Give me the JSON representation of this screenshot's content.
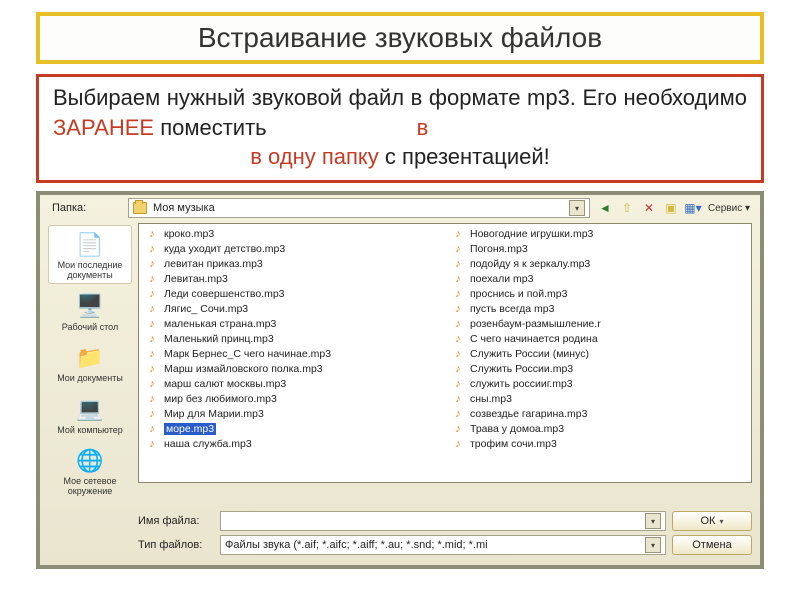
{
  "slide": {
    "title": "Встраивание звуковых файлов",
    "info_line1_pre": "Выбираем нужный звуковой файл в формате mp3. Его необходимо ",
    "info_line1_red1": "ЗАРАНЕЕ",
    "info_line1_mid": " поместить",
    "info_line2_red": "в одну папку",
    "info_line2_rest": " с презентацией!"
  },
  "dialog": {
    "folder_label": "Папка:",
    "folder_value": "Моя музыка",
    "service_label": "Сервис ▾"
  },
  "sidebar": {
    "items": [
      {
        "label": "Мои последние документы"
      },
      {
        "label": "Рабочий стол"
      },
      {
        "label": "Мои документы"
      },
      {
        "label": "Мой компьютер"
      },
      {
        "label": "Мое сетевое окружение"
      }
    ]
  },
  "files": {
    "col1": [
      "кроко.mp3",
      "куда уходит детство.mp3",
      "левитан приказ.mp3",
      "Левитан.mp3",
      "Леди совершенство.mp3",
      "Лягис_ Сочи.mp3",
      "маленькая страна.mp3",
      "Маленький принц.mp3",
      "Марк Бернес_С чего начинае.mp3",
      "Марш измайловского полка.mp3",
      "марш салют москвы.mp3",
      "мир без любимого.mp3",
      "Мир для Марии.mp3",
      "море.mp3",
      "наша служба.mp3"
    ],
    "col2": [
      "Новогодние игрушки.mp3",
      "Погоня.mp3",
      "подойду я к зеркалу.mp3",
      "поехали mp3",
      "проснись и пой.mp3",
      "пусть всегда mp3",
      "розенбаум-размышление.r",
      "С чего начинается родина",
      "Служить России (минус)",
      "Служить России.mp3",
      "служить россииг.mp3",
      "сны.mp3",
      "созвездье гагарина.mp3",
      "Трава у домоа.mp3",
      "трофим сочи.mp3"
    ],
    "selected": "море.mp3"
  },
  "bottom": {
    "name_label": "Имя файла:",
    "name_value": "",
    "type_label": "Тип файлов:",
    "type_value": "Файлы звука (*.aif; *.aifc; *.aiff; *.au; *.snd; *.mid; *.mi",
    "ok": "ОК",
    "cancel": "Отмена"
  }
}
